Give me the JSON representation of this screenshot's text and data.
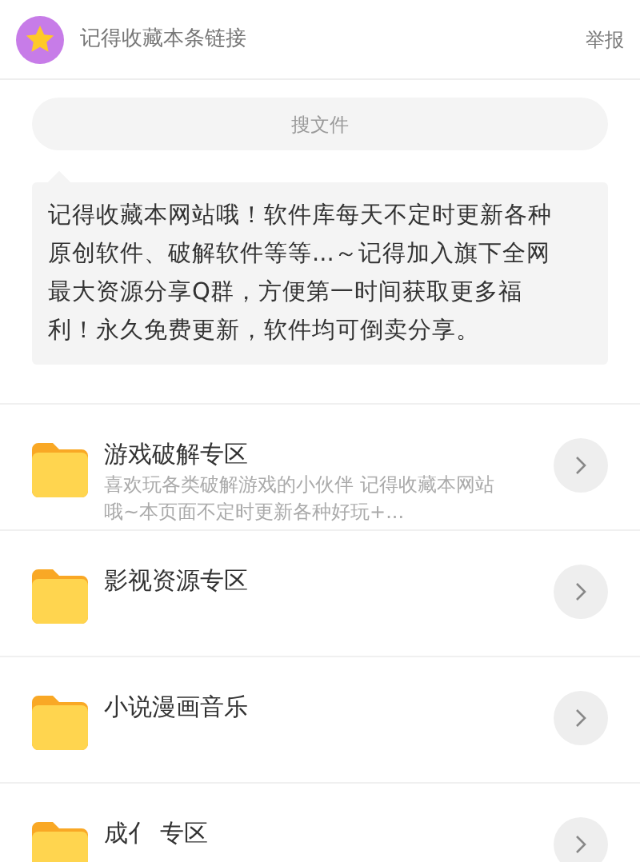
{
  "header": {
    "title": "记得收藏本条链接",
    "report": "举报"
  },
  "search": {
    "placeholder": "搜文件"
  },
  "notice": "记得收藏本网站哦！软件库每天不定时更新各种原创软件、破解软件等等...～记得加入旗下全网最大资源分享Q群，方便第一时间获取更多福利！永久免费更新，软件均可倒卖分享。",
  "folders": [
    {
      "title": "游戏破解专区",
      "description": "喜欢玩各类破解游戏的小伙伴 记得收藏本网站哦~本页面不定时更新各种好玩+..."
    },
    {
      "title": "影视资源专区"
    },
    {
      "title": "小说漫画音乐"
    },
    {
      "title": "成亻 专区"
    }
  ]
}
